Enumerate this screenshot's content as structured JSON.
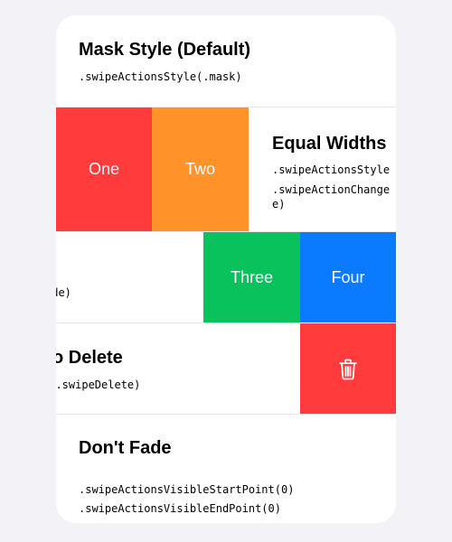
{
  "rows": [
    {
      "title": "Mask Style (Default)",
      "code": [
        ".swipeActionsStyle(.mask)"
      ]
    },
    {
      "title": "Equal Widths",
      "code": [
        ".swipeActionsStyle",
        ".swipeActionChange",
        "e)"
      ],
      "actions": [
        {
          "label": "One",
          "color": "#ff3b3b"
        },
        {
          "label": "Two",
          "color": "#ff9228"
        }
      ]
    },
    {
      "code": [
        "ade)"
      ],
      "actions": [
        {
          "label": "Three",
          "color": "#0ac25c"
        },
        {
          "label": "Four",
          "color": "#0a7aff"
        }
      ]
    },
    {
      "title": "o Delete",
      "code": [
        "n(.swipeDelete)"
      ],
      "actions": [
        {
          "icon": "trash-icon",
          "color": "#ff3b3b"
        }
      ]
    },
    {
      "title": "Don't Fade",
      "code": [
        ".swipeActionsVisibleStartPoint(0)",
        ".swipeActionsVisibleEndPoint(0)"
      ]
    }
  ]
}
